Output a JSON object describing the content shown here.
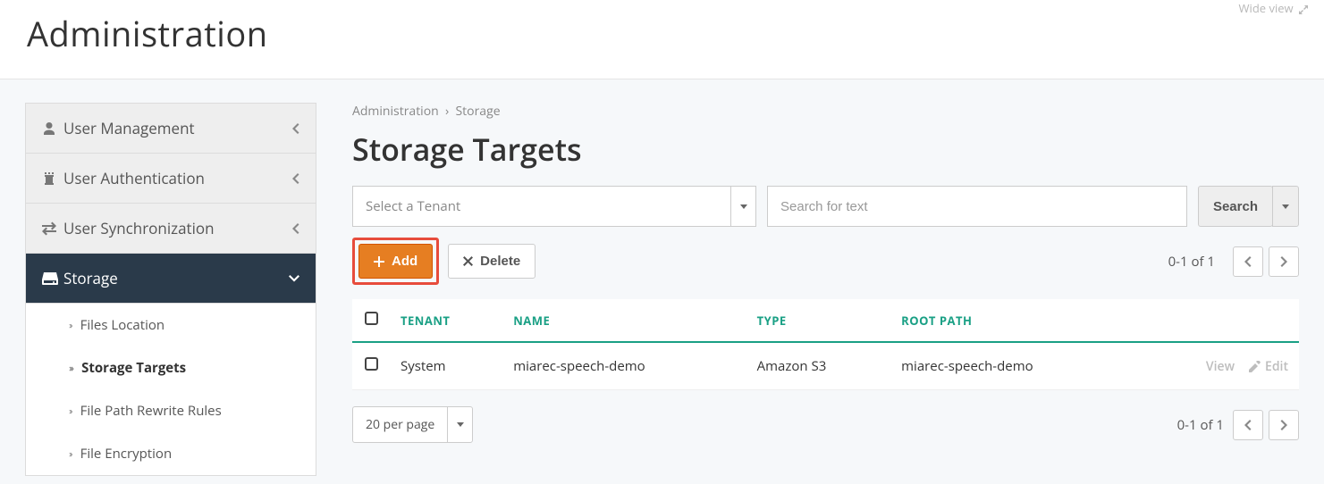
{
  "top": {
    "wide_view": "Wide view",
    "title": "Administration"
  },
  "sidebar": {
    "items": [
      {
        "label": "User Management",
        "icon": "user-icon"
      },
      {
        "label": "User Authentication",
        "icon": "tower-icon"
      },
      {
        "label": "User Synchronization",
        "icon": "sync-icon"
      },
      {
        "label": "Storage",
        "icon": "hdd-icon"
      }
    ],
    "sub": [
      {
        "label": "Files Location"
      },
      {
        "label": "Storage Targets",
        "active": true
      },
      {
        "label": "File Path Rewrite Rules"
      },
      {
        "label": "File Encryption"
      }
    ]
  },
  "breadcrumb": {
    "a": "Administration",
    "b": "Storage"
  },
  "main": {
    "title": "Storage Targets"
  },
  "filters": {
    "tenant_placeholder": "Select a Tenant",
    "search_placeholder": "Search for text",
    "search_btn": "Search"
  },
  "actions": {
    "add": "Add",
    "delete": "Delete"
  },
  "paging": {
    "info": "0-1 of 1",
    "perpage": "20 per page"
  },
  "columns": {
    "tenant": "TENANT",
    "name": "NAME",
    "type": "TYPE",
    "root": "ROOT PATH"
  },
  "rows": [
    {
      "tenant": "System",
      "name": "miarec-speech-demo",
      "type": "Amazon S3",
      "root": "miarec-speech-demo"
    }
  ],
  "row_actions": {
    "view": "View",
    "edit": "Edit"
  }
}
